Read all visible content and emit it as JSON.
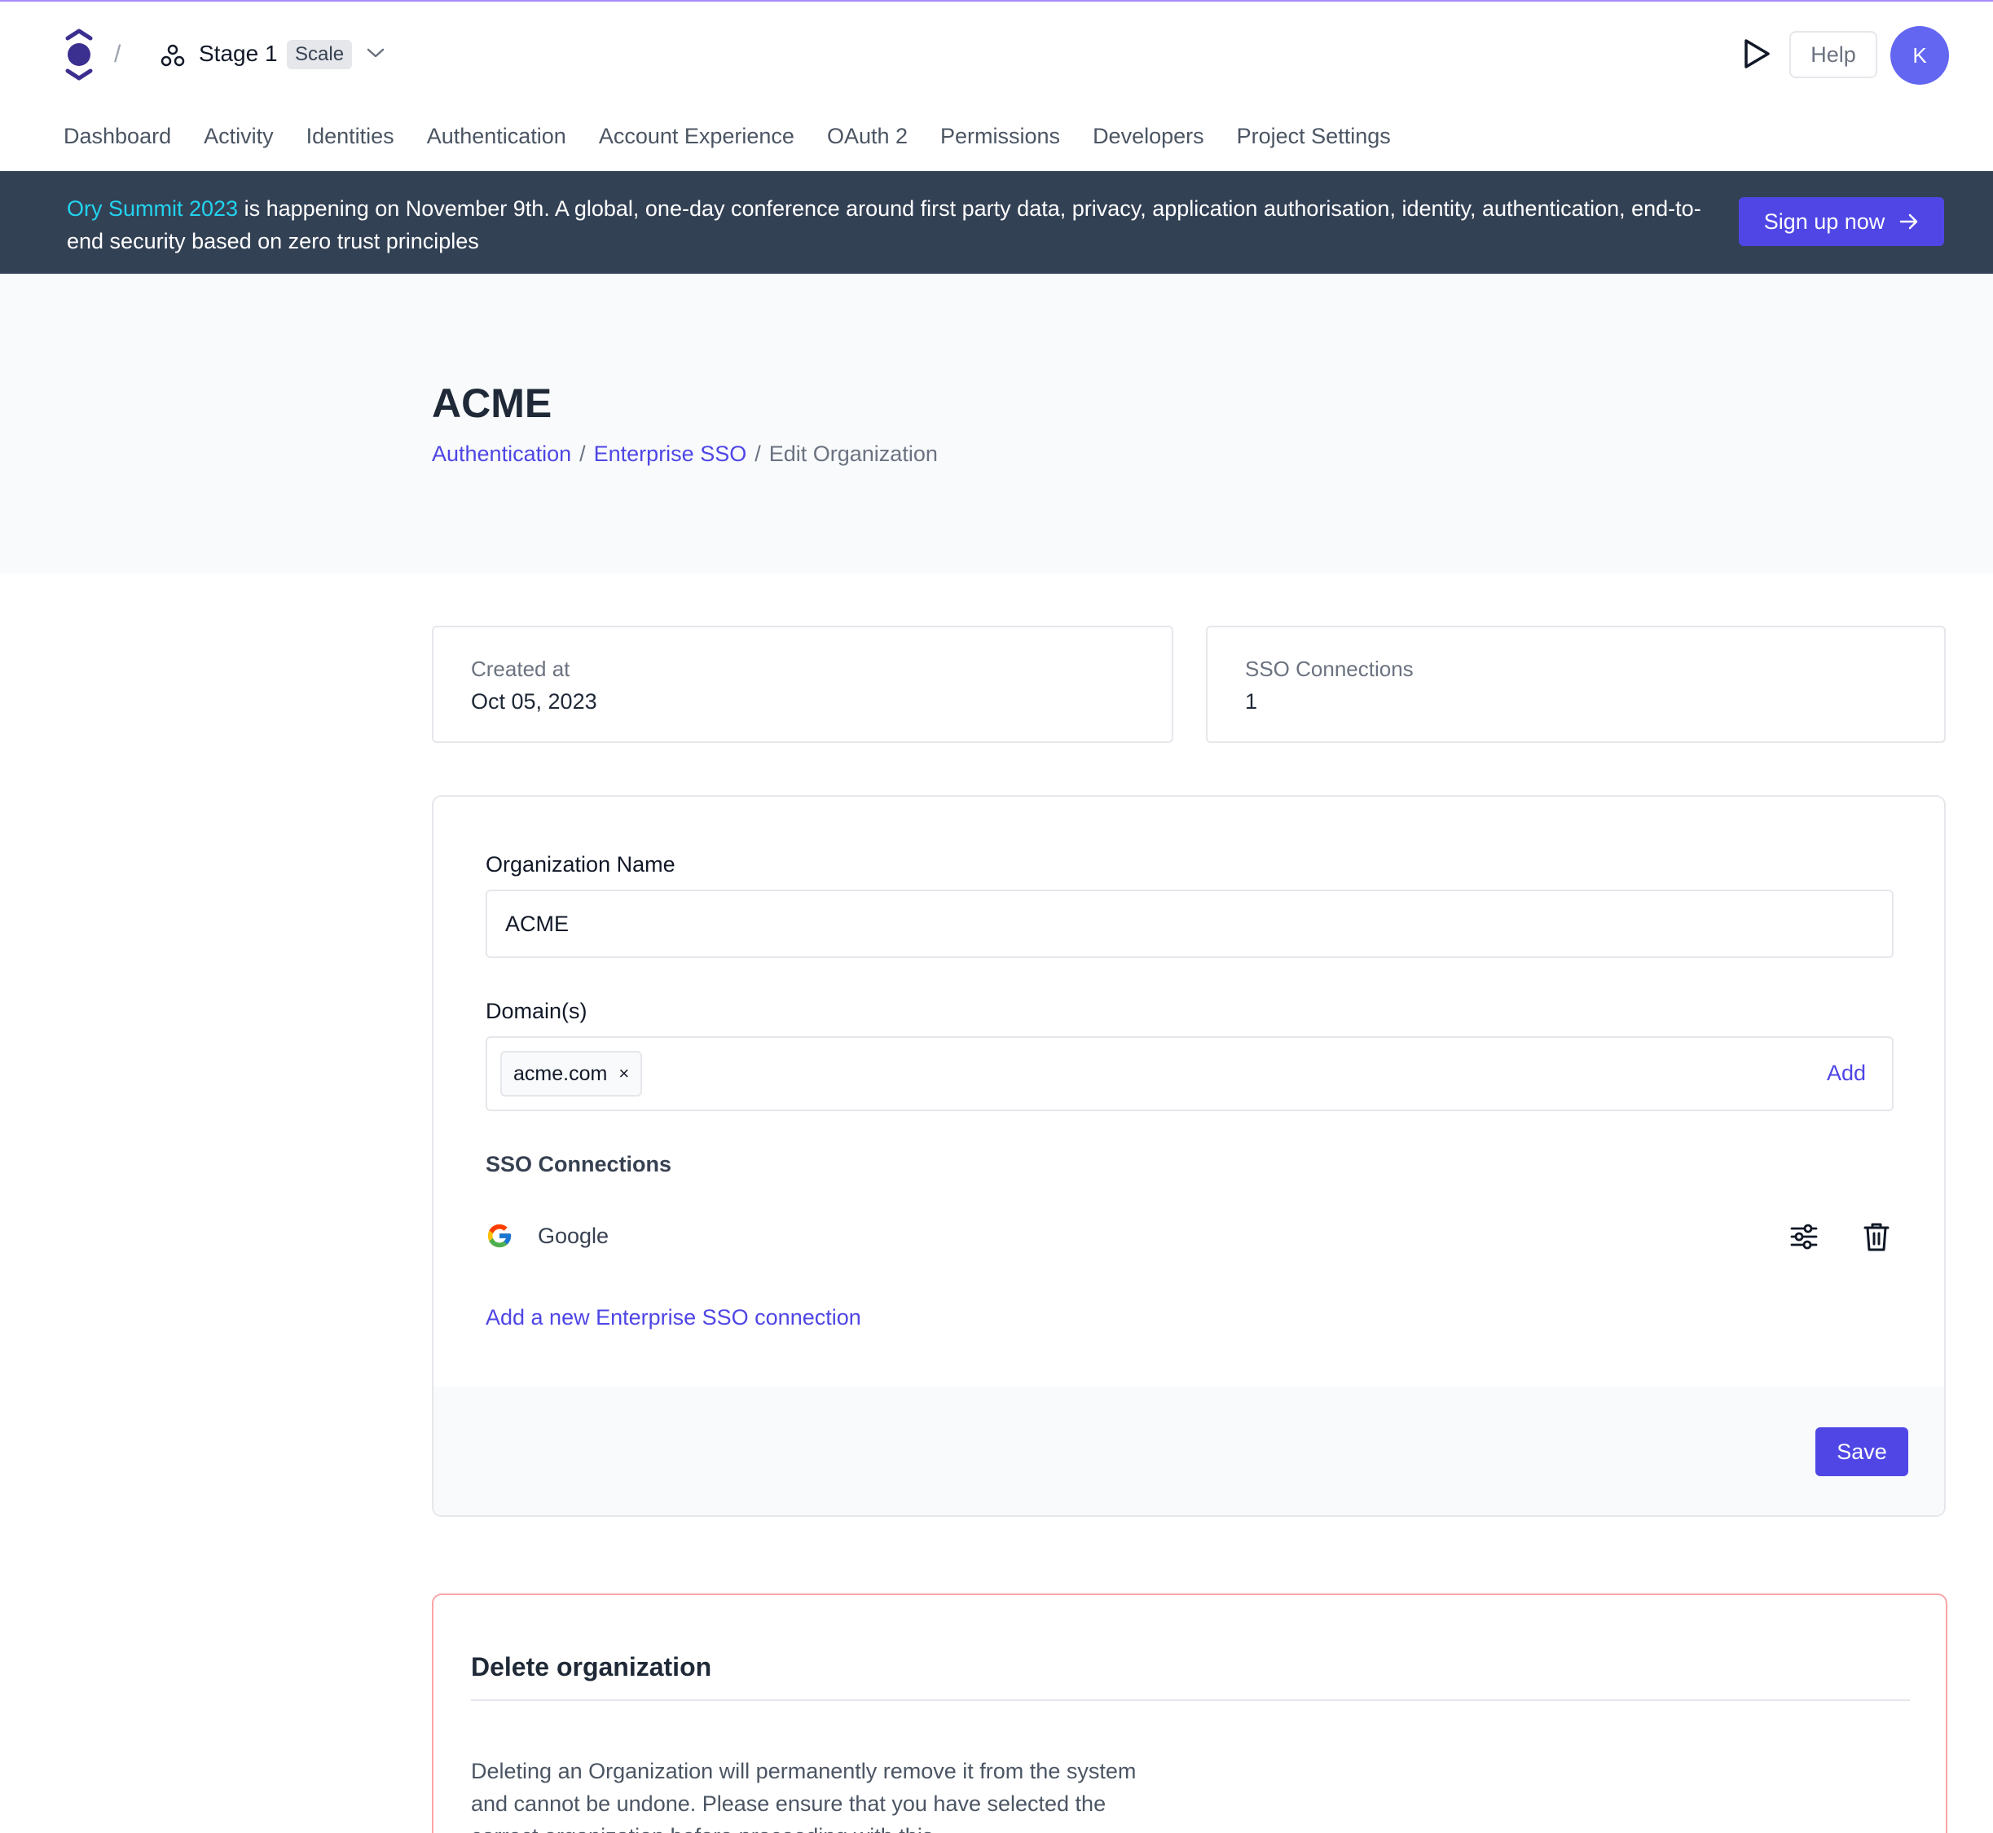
{
  "header": {
    "breadcrumb_separator": "/",
    "project": {
      "name": "Stage 1",
      "plan": "Scale"
    },
    "help_label": "Help",
    "avatar_initial": "K"
  },
  "nav": {
    "items": [
      "Dashboard",
      "Activity",
      "Identities",
      "Authentication",
      "Account Experience",
      "OAuth 2",
      "Permissions",
      "Developers",
      "Project Settings"
    ]
  },
  "banner": {
    "link_text": "Ory Summit 2023",
    "text": " is happening on November 9th. A global, one-day conference around first party data, privacy, application authorisation, identity, authentication, end-to-end security based on zero trust principles",
    "cta_label": "Sign up now",
    "cta_icon": "arrow-right-icon"
  },
  "page": {
    "title": "ACME",
    "breadcrumb": {
      "items": [
        "Authentication",
        "Enterprise SSO"
      ],
      "current": "Edit Organization",
      "separator": "/"
    }
  },
  "stats": {
    "created_label": "Created at",
    "created_value": "Oct 05, 2023",
    "connections_label": "SSO Connections",
    "connections_value": "1"
  },
  "form": {
    "org_name_label": "Organization Name",
    "org_name_value": "ACME",
    "domains_label": "Domain(s)",
    "domains": [
      "acme.com"
    ],
    "domain_remove_glyph": "×",
    "add_label": "Add",
    "sso_label": "SSO Connections",
    "connections": [
      {
        "name": "Google",
        "icon": "google-icon"
      }
    ],
    "new_connection_label": "Add a new Enterprise SSO connection",
    "save_label": "Save"
  },
  "danger": {
    "title": "Delete organization",
    "text": "Deleting an Organization will permanently remove it from the system and cannot be undone. Please ensure that you have selected the correct organization before proceeding with this"
  },
  "colors": {
    "accent": "#4f46e5",
    "banner_bg": "#334155",
    "banner_link": "#22d3ee",
    "hero_bg": "#f8fafc",
    "danger_border": "#fca5a5"
  }
}
